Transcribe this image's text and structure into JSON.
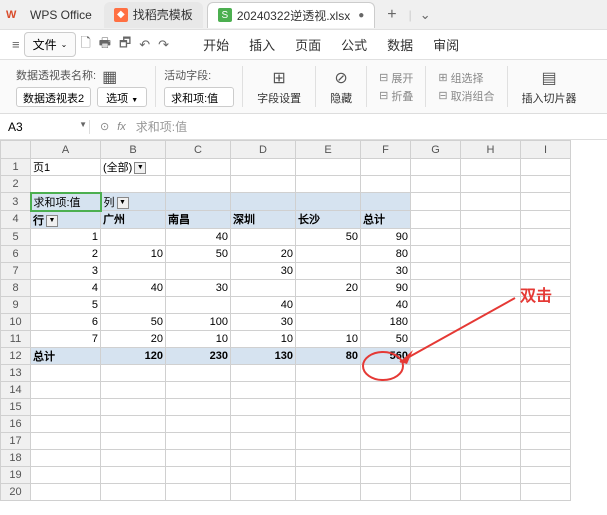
{
  "app": {
    "name": "WPS Office"
  },
  "tabs": [
    {
      "label": "找稻壳模板",
      "icon": "S",
      "active": false
    },
    {
      "label": "20240322逆透视.xlsx",
      "icon": "S",
      "active": true
    }
  ],
  "menu": {
    "file": "文件",
    "items": [
      "开始",
      "插入",
      "页面",
      "公式",
      "数据",
      "审阅"
    ]
  },
  "ribbon": {
    "pivot_name_label": "数据透视表名称:",
    "pivot_name_value": "数据透视表2",
    "options_btn": "选项",
    "active_field_label": "活动字段:",
    "active_field_value": "求和项:值",
    "field_settings": "字段设置",
    "hide": "隐藏",
    "expand": "展开",
    "collapse": "折叠",
    "group_select": "组选择",
    "ungroup": "取消组合",
    "insert_slicer": "插入切片器"
  },
  "ref": {
    "cell": "A3",
    "formula": "求和项:值"
  },
  "columns": [
    "A",
    "B",
    "C",
    "D",
    "E",
    "F",
    "G",
    "H",
    "I"
  ],
  "pivot": {
    "page_field": "页1",
    "page_value": "(全部)",
    "value_label": "求和项:值",
    "col_label": "列",
    "row_label": "行",
    "col_headers": [
      "广州",
      "南昌",
      "深圳",
      "长沙",
      "总计"
    ],
    "rows": [
      {
        "r": "1",
        "v": [
          "",
          "40",
          "",
          "50",
          "90"
        ]
      },
      {
        "r": "2",
        "v": [
          "10",
          "50",
          "20",
          "",
          "80"
        ]
      },
      {
        "r": "3",
        "v": [
          "",
          "",
          "30",
          "",
          "30"
        ]
      },
      {
        "r": "4",
        "v": [
          "40",
          "30",
          "",
          "20",
          "90"
        ]
      },
      {
        "r": "5",
        "v": [
          "",
          "",
          "40",
          "",
          "40"
        ]
      },
      {
        "r": "6",
        "v": [
          "50",
          "100",
          "30",
          "",
          "180"
        ]
      },
      {
        "r": "7",
        "v": [
          "20",
          "10",
          "10",
          "10",
          "50"
        ]
      }
    ],
    "total_label": "总计",
    "totals": [
      "120",
      "230",
      "130",
      "80",
      "560"
    ]
  },
  "annotation": {
    "text": "双击"
  }
}
